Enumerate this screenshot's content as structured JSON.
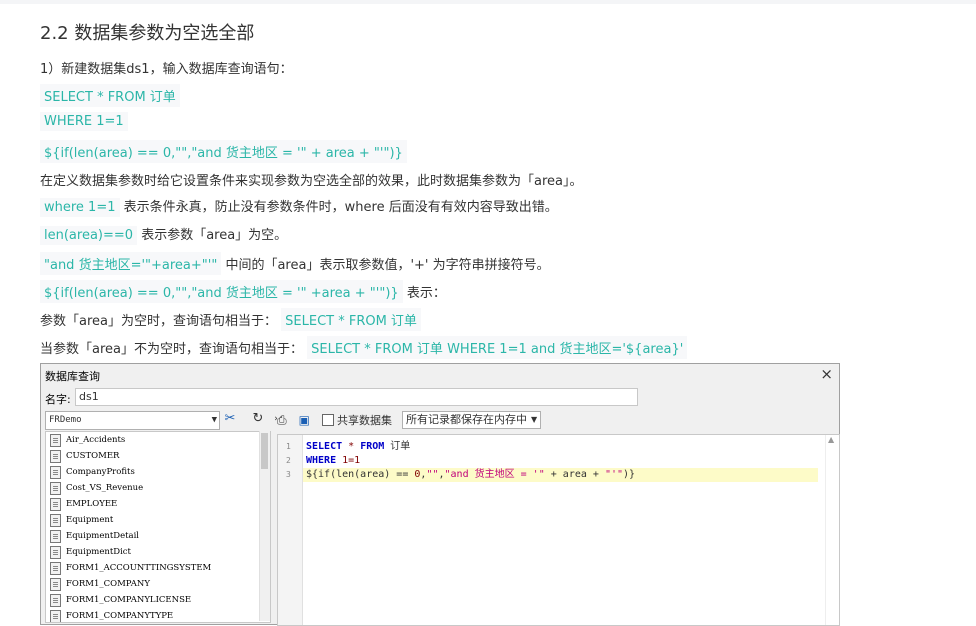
{
  "heading": "2.2 数据集参数为空选全部",
  "step1": "1）新建数据集ds1，输入数据库查询语句：",
  "sql_lines": [
    "SELECT * FROM 订单",
    "WHERE 1=1",
    "${if(len(area) == 0,\"\",\"and 货主地区 = '\" + area + \"'\")}"
  ],
  "explain1": "在定义数据集参数时给它设置条件来实现参数为空选全部的效果，此时数据集参数为「area」。",
  "explain2_code": "where 1=1",
  "explain2_text": "表示条件永真，防止没有参数条件时，where 后面没有有效内容导致出错。",
  "explain3_code": "len(area)==0",
  "explain3_text": "表示参数「area」为空。",
  "explain4_code": "\"and 货主地区='\"+area+\"'\"",
  "explain4_text": "中间的「area」表示取参数值，'+' 为字符串拼接符号。",
  "explain5_code": "${if(len(area) == 0,\"\",\"and 货主地区 = '\" +area + \"'\")}",
  "explain5_text": "表示：",
  "explain6_text": "参数「area」为空时，查询语句相当于：",
  "explain6_code": "SELECT * FROM 订单",
  "explain7_text": "当参数「area」不为空时，查询语句相当于：",
  "explain7_code": "SELECT * FROM 订单 WHERE 1=1 and 货主地区='${area}'",
  "dialog": {
    "title": "数据库查询",
    "close": "×",
    "name_label": "名字:",
    "name_value": "ds1",
    "datasource": "FRDemo",
    "share_label": "共享数据集",
    "cache_option": "所有记录都保存在内存中",
    "tables": [
      "Air_Accidents",
      "CUSTOMER",
      "CompanyProfits",
      "Cost_VS_Revenue",
      "EMPLOYEE",
      "Equipment",
      "EquipmentDetail",
      "EquipmentDict",
      "FORM1_ACCOUNTTINGSYSTEM",
      "FORM1_COMPANY",
      "FORM1_COMPANYLICENSE",
      "FORM1_COMPANYTYPE"
    ],
    "line_numbers": [
      "1",
      "2",
      "3"
    ],
    "editor": {
      "l1_select": "SELECT",
      "l1_star": " * ",
      "l1_from": "FROM",
      "l1_rest": " 订单",
      "l2_where": "WHERE",
      "l2_rest": " 1=1",
      "l3_a": "${if(len(area) == ",
      "l3_num": "0",
      "l3_b": ",",
      "l3_s1": "\"\"",
      "l3_c": ",",
      "l3_s2": "\"and 货主地区 = '\"",
      "l3_d": " + area + ",
      "l3_s3": "\"'\"",
      "l3_e": ")}"
    }
  },
  "colors": {
    "code_accent": "#2bb6a8",
    "code_bg": "#f7f8fa",
    "highlight_line": "#fdfbc8"
  }
}
